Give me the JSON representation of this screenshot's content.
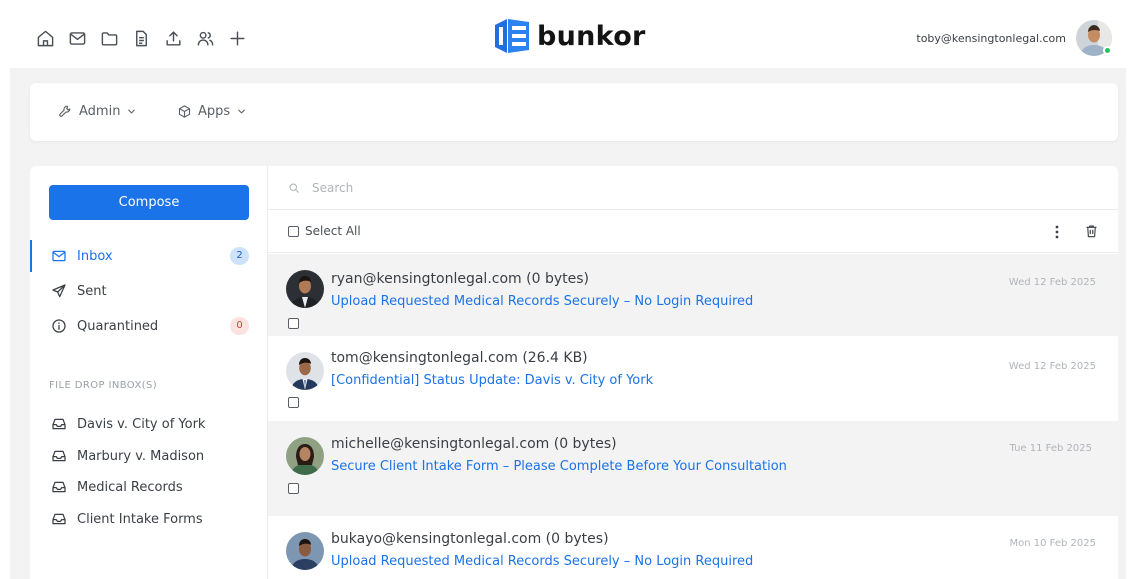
{
  "topbar": {
    "nav_icons": [
      "home-icon",
      "mail-icon",
      "folder-icon",
      "document-icon",
      "upload-icon",
      "users-icon",
      "plus-icon"
    ],
    "logo_text": "bunkor",
    "user_email": "toby@kensingtonlegal.com"
  },
  "adminbar": {
    "admin_label": "Admin",
    "apps_label": "Apps"
  },
  "sidebar": {
    "compose_label": "Compose",
    "folders": [
      {
        "label": "Inbox",
        "icon": "mail-icon",
        "badge": "2",
        "active": true
      },
      {
        "label": "Sent",
        "icon": "send-icon"
      },
      {
        "label": "Quarantined",
        "icon": "info-icon",
        "badge": "0"
      }
    ],
    "file_drop_title": "FILE DROP INBOX(S)",
    "file_drop_items": [
      "Davis v. City of York",
      "Marbury v. Madison",
      "Medical Records",
      "Client Intake Forms"
    ]
  },
  "main": {
    "search_placeholder": "Search",
    "select_all_label": "Select All",
    "messages": [
      {
        "from": "ryan@kensingtonlegal.com (0 bytes)",
        "subject": "Upload Requested Medical Records Securely – No Login Required",
        "date": "Wed 12 Feb 2025"
      },
      {
        "from": "tom@kensingtonlegal.com (26.4 KB)",
        "subject": "[Confidential] Status Update: Davis v. City of York",
        "date": "Wed 12 Feb 2025"
      },
      {
        "from": "michelle@kensingtonlegal.com (0 bytes)",
        "subject": "Secure Client Intake Form – Please Complete Before Your Consultation",
        "date": "Tue 11 Feb 2025"
      },
      {
        "from": "bukayo@kensingtonlegal.com (0 bytes)",
        "subject": "Upload Requested Medical Records Securely – No Login Required",
        "date": "Mon 10 Feb 2025"
      }
    ]
  },
  "colors": {
    "accent": "#1a73e8",
    "online": "#22c55e",
    "badge_blue_bg": "#cfe2fb",
    "badge_red_bg": "#fde2e2"
  }
}
